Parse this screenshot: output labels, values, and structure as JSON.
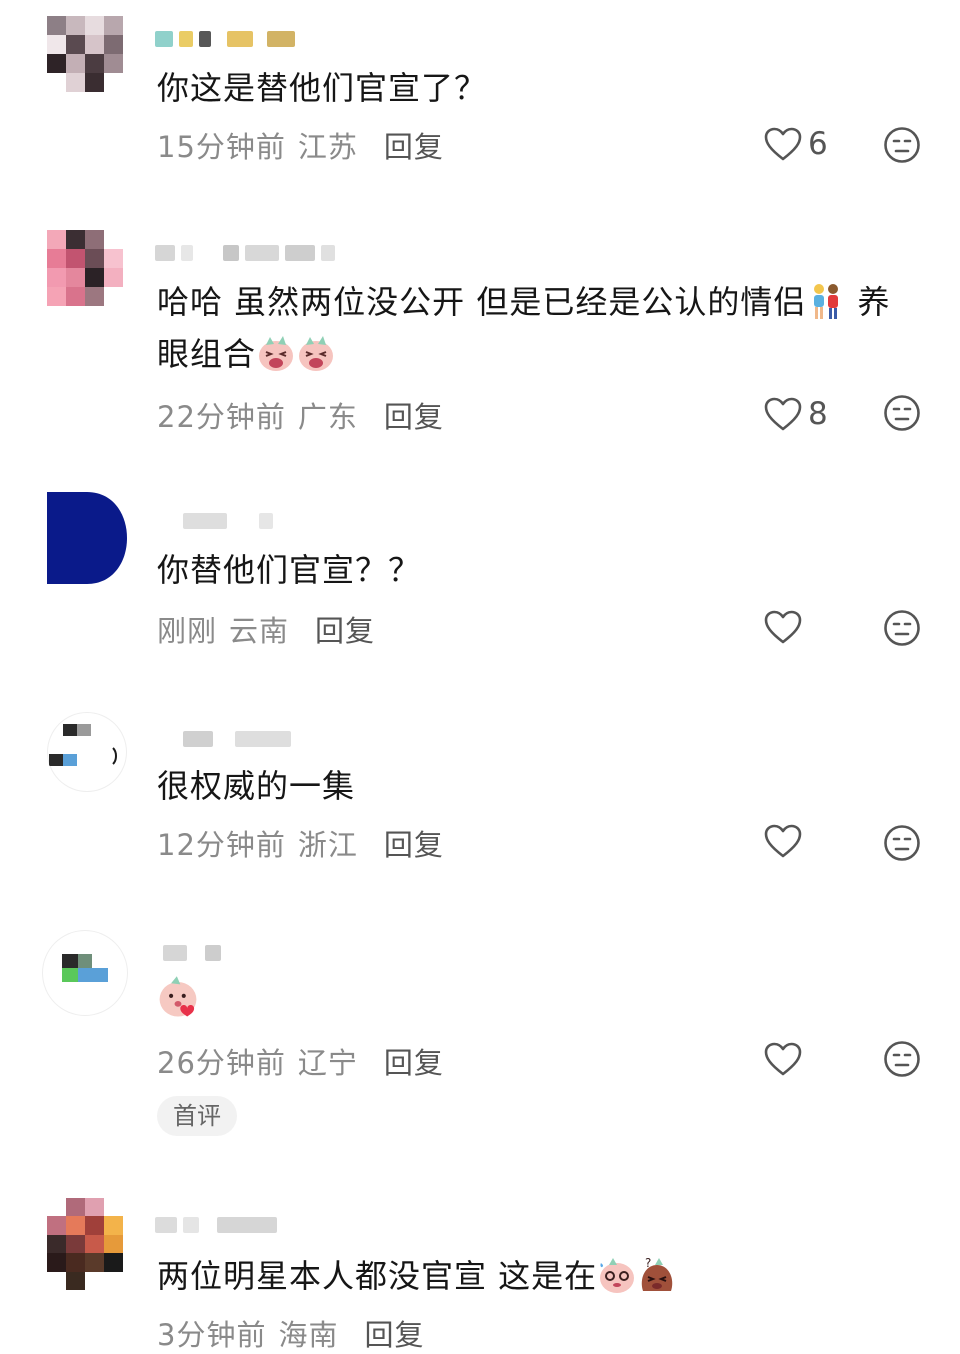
{
  "comments": [
    {
      "text": "你这是替他们官宣了？",
      "time": "15分钟前",
      "location": "江苏",
      "reply_label": "回复",
      "likes": "6"
    },
    {
      "text": "哈哈 虽然两位没公开 但是已经是公认的情侣",
      "text_tail": " 养",
      "text_line2": "眼组合",
      "time": "22分钟前",
      "location": "广东",
      "reply_label": "回复",
      "likes": "8"
    },
    {
      "text": "你替他们官宣？？",
      "time": "刚刚",
      "location": "云南",
      "reply_label": "回复",
      "likes": ""
    },
    {
      "text": "很权威的一集",
      "time": "12分钟前",
      "location": "浙江",
      "reply_label": "回复",
      "likes": ""
    },
    {
      "text": "",
      "time": "26分钟前",
      "location": "辽宁",
      "reply_label": "回复",
      "likes": "",
      "badge": "首评"
    },
    {
      "text": "两位明星本人都没官宣 这是在",
      "time": "3分钟前",
      "location": "海南",
      "reply_label": "回复",
      "likes": ""
    }
  ],
  "icons": {
    "like": "heart-outline-icon",
    "emoji": "neutral-face-icon"
  },
  "colors": {
    "text": "#161616",
    "meta": "#8a8a8a",
    "icon": "#555555",
    "badge_bg": "#f2f2f2"
  }
}
